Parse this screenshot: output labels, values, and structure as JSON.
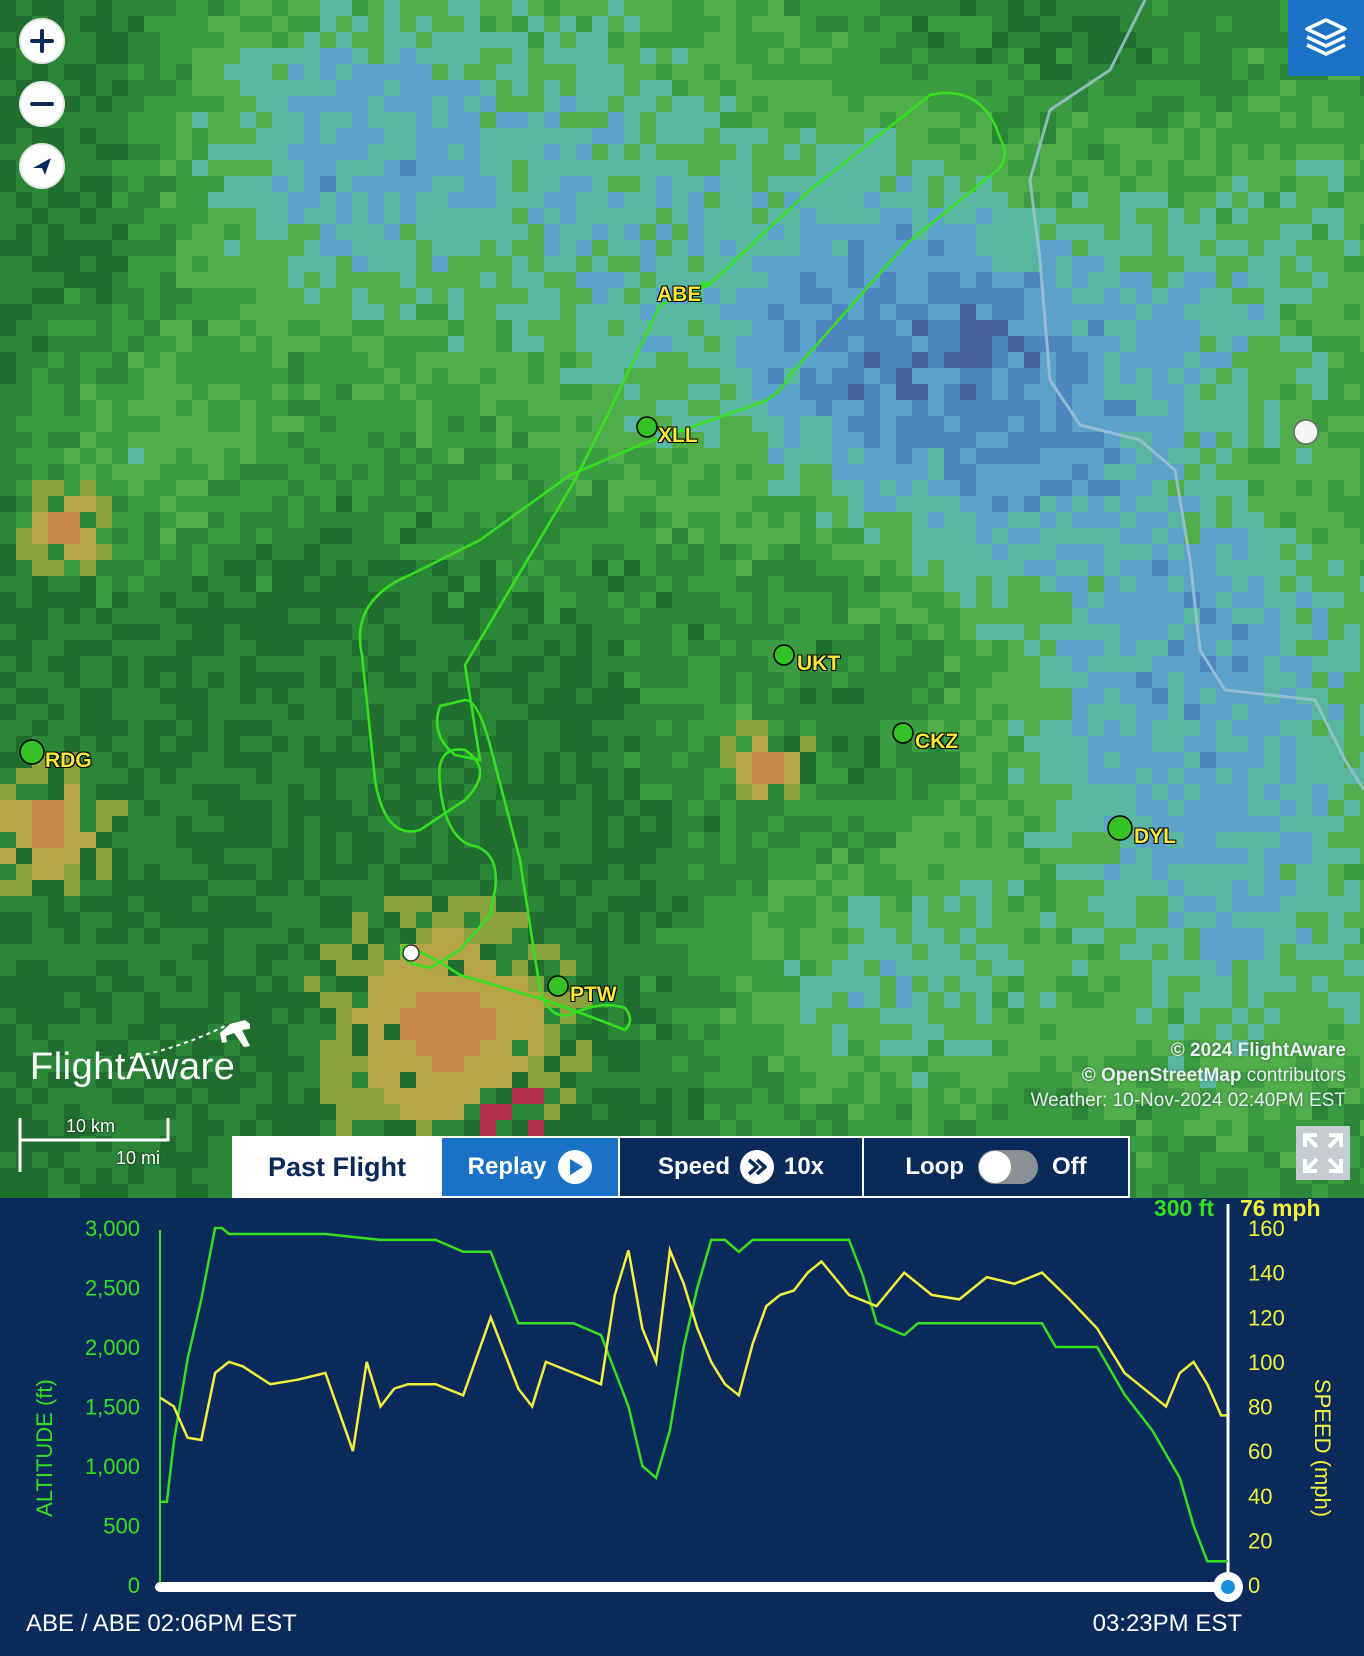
{
  "map": {
    "zoom_controls": {
      "zoom_in": "+",
      "zoom_out": "−"
    },
    "airports": [
      {
        "code": "ABE",
        "has_marker": false
      },
      {
        "code": "XLL",
        "has_marker": true
      },
      {
        "code": "UKT",
        "has_marker": true
      },
      {
        "code": "CKZ",
        "has_marker": true
      },
      {
        "code": "RDG",
        "has_marker": true
      },
      {
        "code": "DYL",
        "has_marker": true
      },
      {
        "code": "PTW",
        "has_marker": true
      }
    ],
    "logo": "FlightAware",
    "attribution": {
      "line1": "© 2024 FlightAware",
      "line2_bold": "© OpenStreetMap",
      "line2_rest": " contributors",
      "line3": "Weather: 10-Nov-2024 02:40PM EST"
    },
    "scale": {
      "km": "10 km",
      "mi": "10 mi"
    },
    "flight_track_color": "#33e11f"
  },
  "toolbar": {
    "past_flight": "Past Flight",
    "replay": "Replay",
    "speed_label": "Speed",
    "speed_value": "10x",
    "loop_label": "Loop",
    "loop_state": "Off",
    "loop_on": false
  },
  "chart_data": {
    "type": "line",
    "current_altitude": "300 ft",
    "current_speed": "76 mph",
    "ylabel_left": "ALTITUDE (ft)",
    "ylabel_right": "SPEED (mph)",
    "left_ticks": [
      "3,000",
      "2,500",
      "2,000",
      "1,500",
      "1,000",
      "500",
      "0"
    ],
    "right_ticks": [
      "160",
      "140",
      "120",
      "100",
      "80",
      "60",
      "40",
      "20",
      "0"
    ],
    "ylim_left": [
      0,
      3000
    ],
    "ylim_right": [
      0,
      160
    ],
    "x_range": [
      "02:06PM",
      "03:23PM"
    ],
    "series": [
      {
        "name": "altitude",
        "color": "#33e11f",
        "x": [
          0,
          0.5,
          1,
          2,
          3,
          4,
          4.5,
          5,
          6,
          8,
          12,
          16,
          20,
          22,
          24,
          25,
          26,
          28,
          30,
          32,
          33,
          34,
          35,
          36,
          37,
          38,
          39,
          40,
          41,
          42,
          43,
          44,
          45,
          46,
          47,
          48,
          50,
          51,
          52,
          54,
          55,
          56,
          57,
          58,
          60,
          62,
          63,
          64,
          65,
          66,
          67,
          68,
          70,
          72,
          74,
          75,
          76,
          77,
          77.5
        ],
        "y": [
          700,
          700,
          1200,
          1900,
          2400,
          3000,
          3000,
          2950,
          2950,
          2950,
          2950,
          2900,
          2900,
          2800,
          2800,
          2500,
          2200,
          2200,
          2200,
          2100,
          1800,
          1500,
          1000,
          900,
          1300,
          2000,
          2500,
          2900,
          2900,
          2800,
          2900,
          2900,
          2900,
          2900,
          2900,
          2900,
          2900,
          2600,
          2200,
          2100,
          2200,
          2200,
          2200,
          2200,
          2200,
          2200,
          2200,
          2200,
          2000,
          2000,
          2000,
          2000,
          1600,
          1300,
          900,
          500,
          200,
          200,
          200
        ]
      },
      {
        "name": "speed",
        "color": "#f2f23a",
        "x": [
          0,
          1,
          2,
          3,
          4,
          5,
          6,
          8,
          10,
          12,
          14,
          15,
          16,
          17,
          18,
          20,
          22,
          24,
          26,
          27,
          28,
          30,
          32,
          33,
          34,
          35,
          36,
          37,
          38,
          39,
          40,
          41,
          42,
          43,
          44,
          45,
          46,
          47,
          48,
          50,
          52,
          54,
          56,
          58,
          60,
          62,
          64,
          66,
          68,
          70,
          71,
          72,
          73,
          74,
          75,
          76,
          77,
          77.5
        ],
        "y": [
          84,
          80,
          66,
          65,
          95,
          100,
          98,
          90,
          92,
          95,
          60,
          100,
          80,
          88,
          90,
          90,
          85,
          120,
          88,
          80,
          100,
          95,
          90,
          130,
          150,
          115,
          100,
          150,
          135,
          115,
          100,
          90,
          85,
          108,
          125,
          130,
          132,
          140,
          145,
          130,
          125,
          140,
          130,
          128,
          138,
          135,
          140,
          128,
          115,
          95,
          90,
          85,
          80,
          95,
          100,
          90,
          76,
          76
        ]
      }
    ]
  },
  "footer": {
    "route": "ABE / ABE 02:06PM EST",
    "end_time": "03:23PM EST"
  }
}
